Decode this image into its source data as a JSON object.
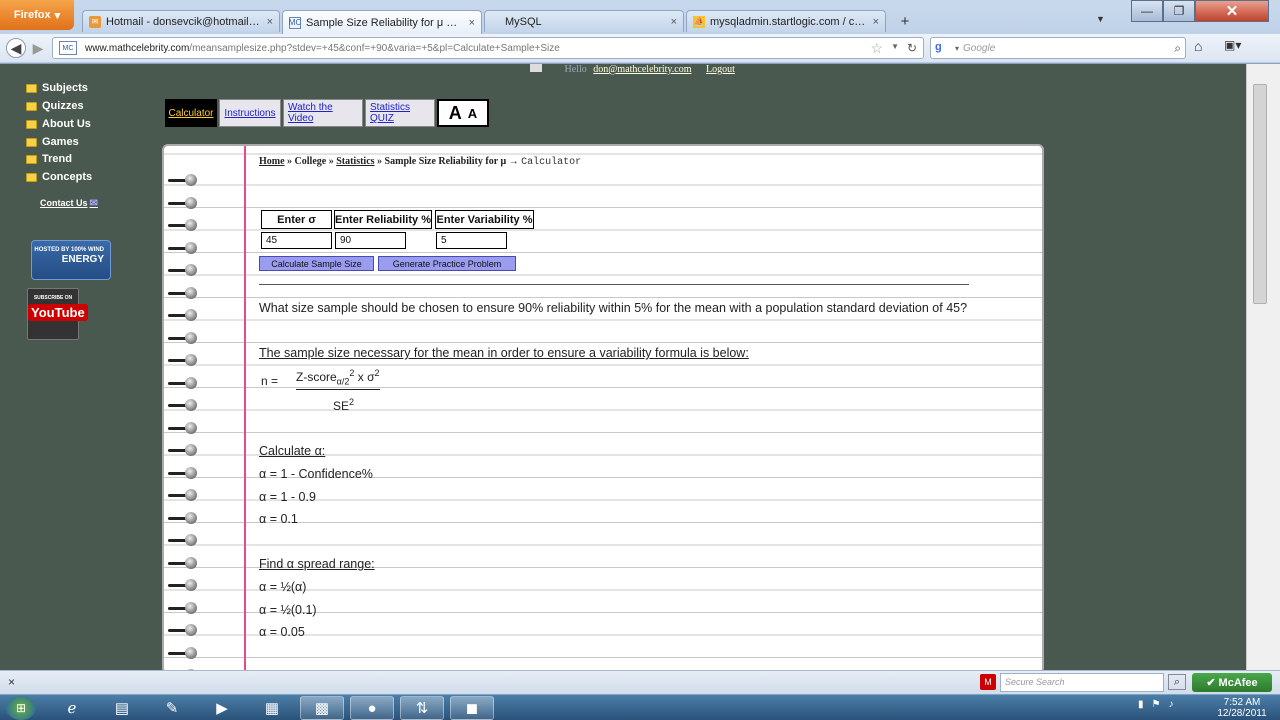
{
  "browser": {
    "menu_label": "Firefox",
    "tabs": [
      {
        "label": "Hotmail - donsevcik@hotmail.com",
        "icon": "mail-icon",
        "close": "×"
      },
      {
        "label": "Sample Size Reliability for μ Calculator",
        "icon": "mc-favicon-icon",
        "close": "×",
        "active": true
      },
      {
        "label": "MySQL",
        "icon": "",
        "close": "×"
      },
      {
        "label": "mysqladmin.startlogic.com / custsql-...",
        "icon": "pma-icon",
        "close": "×"
      }
    ],
    "new_tab": "+",
    "url_host": "www.mathcelebrity.com",
    "url_path": "/meansamplesize.php?stdev=+45&conf=+90&varia=+5&pl=Calculate+Sample+Size",
    "search_placeholder": "Google",
    "search_engine_letter": "g"
  },
  "page": {
    "top_strip": {
      "label": "Hello",
      "email": "don@mathcelebrity.com",
      "logout": "Logout"
    },
    "sidebar": {
      "items": [
        {
          "label": "Subjects"
        },
        {
          "label": "Quizzes"
        },
        {
          "label": "About Us"
        },
        {
          "label": "Games"
        },
        {
          "label": "Trend"
        },
        {
          "label": "Concepts"
        }
      ],
      "contact": "Contact Us"
    },
    "badges": {
      "wind_small": "HOSTED BY 100% WIND",
      "wind_big": "ENERGY",
      "youtube_small": "SUBSCRIBE ON",
      "youtube_logo": "YouTube"
    },
    "toolbar": {
      "calculator": "Calculator",
      "instructions": "Instructions",
      "video": "Watch the Video",
      "quiz": "Statistics QUIZ",
      "font_big": "A",
      "font_small": "A"
    },
    "breadcrumb": {
      "home": "Home",
      "sep1": "»",
      "college": "College",
      "sep2": "»",
      "statistics": "Statistics",
      "sep3": "»",
      "current": "Sample Size Reliability for μ",
      "arrow": "→",
      "calc": "Calculator"
    },
    "form": {
      "sigma_label": "Enter σ",
      "reliability_label": "Enter Reliability %",
      "variability_label": "Enter Variability %",
      "sigma_value": "45",
      "reliability_value": "90",
      "variability_value": "5",
      "calc_button": "Calculate Sample Size",
      "practice_button": "Generate Practice Problem"
    },
    "content": {
      "question": "What size sample should be chosen to ensure 90% reliability within 5% for the mean with a population standard deviation of 45?",
      "formula_intro": "The sample size necessary for the mean in order to ensure a variability formula is below:",
      "formula_n": "n  =",
      "formula_num_a": "Z-score",
      "formula_num_sub": "α/2",
      "formula_num_sup": "2",
      "formula_num_b": " x σ",
      "formula_num_sup2": "2",
      "formula_den": "SE",
      "formula_den_sup": "2",
      "calc_alpha_head": "Calculate α:",
      "alpha1": "α = 1 - Confidence%",
      "alpha2": "α = 1 - 0.9",
      "alpha3": "α = 0.1",
      "spread_head": "Find α spread range:",
      "spread1": "α = ½(α)",
      "spread2": "α = ½(0.1)",
      "spread3": "α = 0.05"
    }
  },
  "statusbar": {
    "close": "×",
    "secure_search": "Secure Search",
    "mcafee": "McAfee"
  },
  "taskbar": {
    "time": "7:52 AM",
    "date": "12/28/2011"
  }
}
